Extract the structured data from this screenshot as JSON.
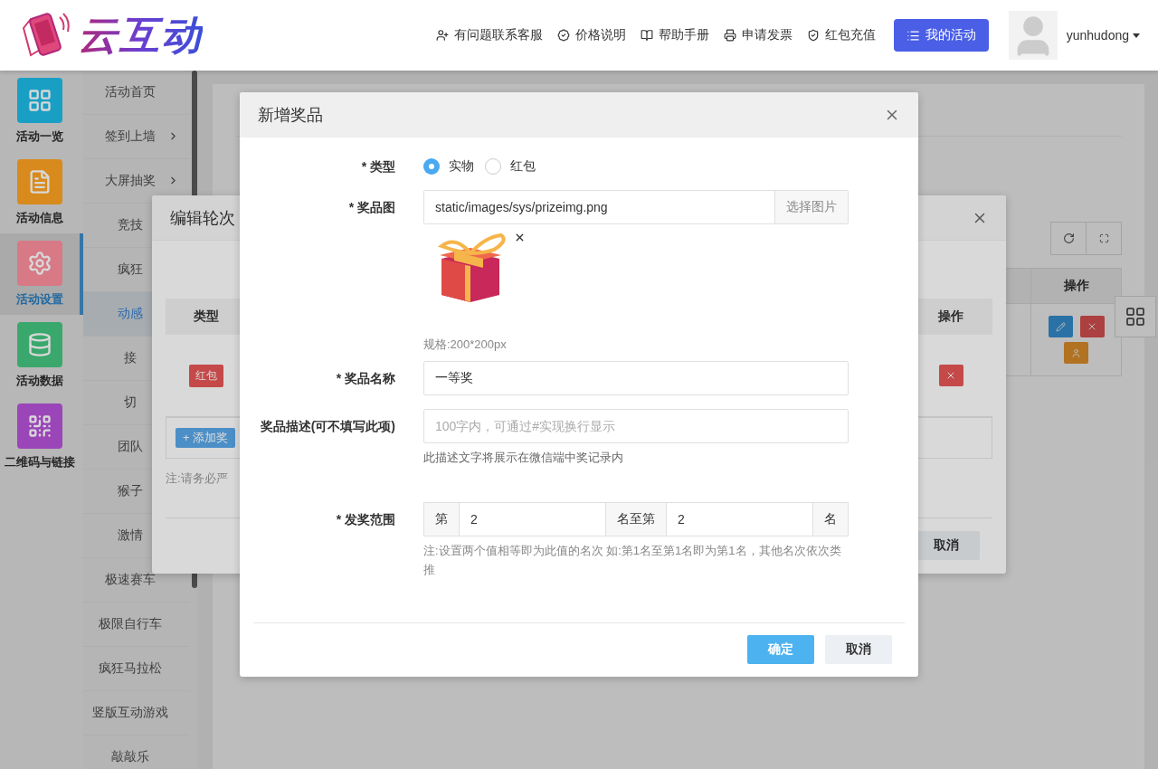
{
  "header": {
    "logo_text": "云互动",
    "links": [
      {
        "kind": "user-plus",
        "label": "有问题联系客服"
      },
      {
        "kind": "badge",
        "label": "价格说明"
      },
      {
        "kind": "book",
        "label": "帮助手册"
      },
      {
        "kind": "printer",
        "label": "申请发票"
      },
      {
        "kind": "shield",
        "label": "红包充值"
      }
    ],
    "primary_button": "我的活动",
    "username": "yunhudong"
  },
  "sidebar": {
    "items": [
      {
        "label": "活动一览",
        "kind": "grid",
        "color": "#1a9fc4",
        "selected": false
      },
      {
        "label": "活动信息",
        "kind": "document",
        "color": "#d88a1c",
        "selected": false
      },
      {
        "label": "活动设置",
        "kind": "gear",
        "color": "#d77a86",
        "selected": true
      },
      {
        "label": "活动数据",
        "kind": "database",
        "color": "#3aa86c",
        "selected": false
      },
      {
        "label": "二维码与链接",
        "kind": "qrcode",
        "color": "#9a46b8",
        "selected": false
      }
    ]
  },
  "submenu": {
    "items": [
      {
        "label": "活动首页",
        "expandable": false,
        "selected": false
      },
      {
        "label": "签到上墙",
        "expandable": true,
        "selected": false
      },
      {
        "label": "大屏抽奖",
        "expandable": true,
        "selected": false
      },
      {
        "label": "竞技",
        "expandable": false,
        "selected": false
      },
      {
        "label": "疯狂",
        "expandable": false,
        "selected": false
      },
      {
        "label": "动感",
        "expandable": false,
        "selected": true
      },
      {
        "label": "接",
        "expandable": false,
        "selected": false
      },
      {
        "label": "切",
        "expandable": false,
        "selected": false
      },
      {
        "label": "团队",
        "expandable": false,
        "selected": false
      },
      {
        "label": "猴子",
        "expandable": false,
        "selected": false
      },
      {
        "label": "激情",
        "expandable": false,
        "selected": false
      },
      {
        "label": "极速赛车",
        "expandable": false,
        "selected": false
      },
      {
        "label": "极限自行车",
        "expandable": false,
        "selected": false
      },
      {
        "label": "疯狂马拉松",
        "expandable": false,
        "selected": false
      },
      {
        "label": "竖版互动游戏",
        "expandable": false,
        "selected": false
      },
      {
        "label": "敲敲乐",
        "expandable": false,
        "selected": false
      }
    ]
  },
  "main": {
    "table": {
      "columns": [
        "操作"
      ]
    }
  },
  "round_dialog": {
    "title": "编辑轮次",
    "columns": [
      "类型",
      "操作"
    ],
    "rows": [
      {
        "tag": "红包"
      }
    ],
    "add_button": "+ 添加奖",
    "note": "注:请务必严",
    "buttons": [
      "取消"
    ]
  },
  "prize_dialog": {
    "title": "新增奖品",
    "fields": [
      {
        "kind": "radio",
        "label": "* 类型",
        "options": [
          {
            "label": "实物",
            "selected": true
          },
          {
            "label": "红包",
            "selected": false
          }
        ]
      },
      {
        "kind": "image",
        "label": "* 奖品图",
        "value": "static/images/sys/prizeimg.png",
        "button": "选择图片",
        "hint": "规格:200*200px"
      },
      {
        "kind": "text",
        "label": "* 奖品名称",
        "value": "一等奖"
      },
      {
        "kind": "text",
        "label": "奖品描述(可不填写此项)",
        "placeholder": "100字内，可通过#实现换行显示",
        "hint": "此描述文字将展示在微信端中奖记录内"
      },
      {
        "kind": "range",
        "label": "* 发奖范围",
        "prefix": "第",
        "from": "2",
        "middle": "名至第",
        "to": "2",
        "suffix": "名",
        "hint": "注:设置两个值相等即为此值的名次 如:第1名至第1名即为第1名，其他名次依次类推"
      }
    ],
    "buttons": [
      {
        "label": "确定",
        "kind": "primary"
      },
      {
        "label": "取消",
        "kind": "default"
      }
    ]
  }
}
